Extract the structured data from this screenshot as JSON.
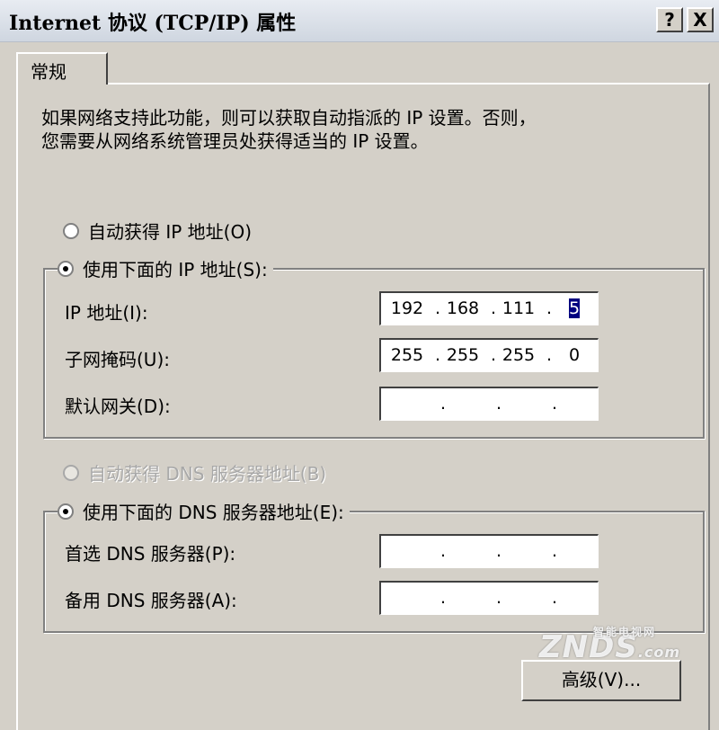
{
  "window": {
    "title": "Internet 协议 (TCP/IP) 属性",
    "help_label": "?",
    "close_label": "X"
  },
  "tabs": [
    {
      "label": "常规",
      "selected": true
    }
  ],
  "description": {
    "line1": "如果网络支持此功能，则可以获取自动指派的 IP 设置。否则，",
    "line2": "您需要从网络系统管理员处获得适当的 IP 设置。"
  },
  "ip_section": {
    "auto_label": "自动获得 IP 地址(O)",
    "manual_label": "使用下面的 IP 地址(S):",
    "selected": "manual",
    "fields": [
      {
        "label": "IP 地址(I):",
        "octets": [
          "192",
          "168",
          "111",
          "5"
        ]
      },
      {
        "label": "子网掩码(U):",
        "octets": [
          "255",
          "255",
          "255",
          "0"
        ]
      },
      {
        "label": "默认网关(D):",
        "octets": [
          "",
          "",
          "",
          ""
        ]
      }
    ]
  },
  "dns_section": {
    "auto_label": "自动获得 DNS 服务器地址(B)",
    "auto_disabled": true,
    "manual_label": "使用下面的 DNS 服务器地址(E):",
    "selected": "manual",
    "fields": [
      {
        "label": "首选 DNS 服务器(P):",
        "octets": [
          "",
          "",
          "",
          ""
        ]
      },
      {
        "label": "备用 DNS 服务器(A):",
        "octets": [
          "",
          "",
          "",
          ""
        ]
      }
    ]
  },
  "buttons": {
    "advanced_label": "高级(V)..."
  },
  "watermark": {
    "brand": "ZNDS",
    "tagline": "智能电视网",
    "suffix": ".com"
  },
  "colors": {
    "dialog_bg": "#d4d0c8",
    "selection": "#000080"
  }
}
